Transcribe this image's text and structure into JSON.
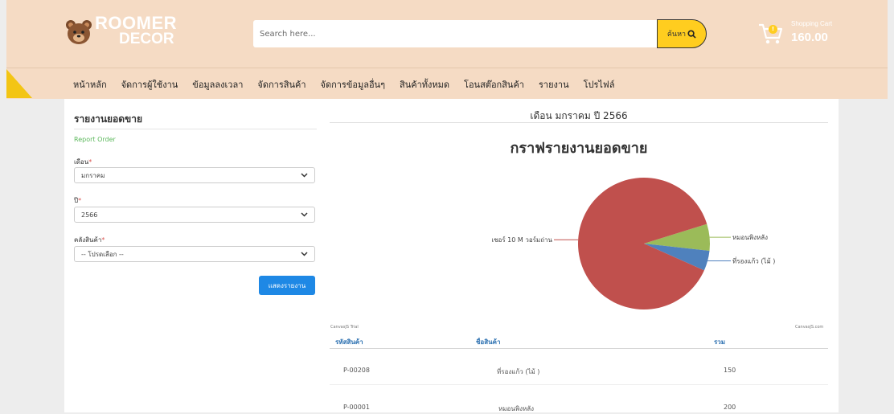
{
  "header": {
    "logo_line1": "ROOMER",
    "logo_line2": "DECOR",
    "search_placeholder": "Search here...",
    "search_button_label": "ค้นหา",
    "cart_badge": "!",
    "cart_title": "Shopping Cart",
    "cart_amount": "160.00",
    "brand_color": "#ffcd1f",
    "band_color": "#f5dbc4"
  },
  "nav": {
    "items": [
      {
        "label": "หน้าหลัก"
      },
      {
        "label": "จัดการผู้ใช้งาน"
      },
      {
        "label": "ข้อมูลลงเวลา"
      },
      {
        "label": "จัดการสินค้า"
      },
      {
        "label": "จัดการข้อมูลอื่นๆ"
      },
      {
        "label": "สินค้าทั้งหมด"
      },
      {
        "label": "โอนสต๊อกสินค้า"
      },
      {
        "label": "รายงาน"
      },
      {
        "label": "โปรไฟล์"
      }
    ]
  },
  "sidebar": {
    "title": "รายงานยอดขาย",
    "subtitle": "Report Order",
    "month_label": "เดือน",
    "month_value": "มกราคม",
    "year_label": "ปี",
    "year_value": "2566",
    "warehouse_label": "คลังสินค้า",
    "warehouse_value": "-- โปรดเลือก --",
    "required_mark": "*",
    "submit_label": "แสดงรายงาน"
  },
  "main": {
    "month_title": "เดือน มกราคม ปี 2566",
    "canvas_trial": "CanvasJS Trial",
    "canvas_com": "CanvasJS.com",
    "table": {
      "headers": [
        "รหัสสินค้า",
        "ชื่อสินค้า",
        "รวม"
      ],
      "rows": [
        {
          "code": "P-00208",
          "name": "ที่รองแก้ว (ไม้ )",
          "total": "150"
        },
        {
          "code": "P-00001",
          "name": "หมอนพิงหลัง",
          "total": "200"
        }
      ]
    }
  },
  "chart_data": {
    "type": "pie",
    "title": "กราฟรายงานยอดขาย",
    "labels": [
      "หมอนพิงหลัง",
      "ที่รองแก้ว (ไม้ )",
      "เชอร์ 10 M วอร์มถ่าน"
    ],
    "values": [
      200,
      150,
      2700
    ],
    "colors": [
      "#9bbb59",
      "#4f81bd",
      "#c0504d"
    ]
  }
}
